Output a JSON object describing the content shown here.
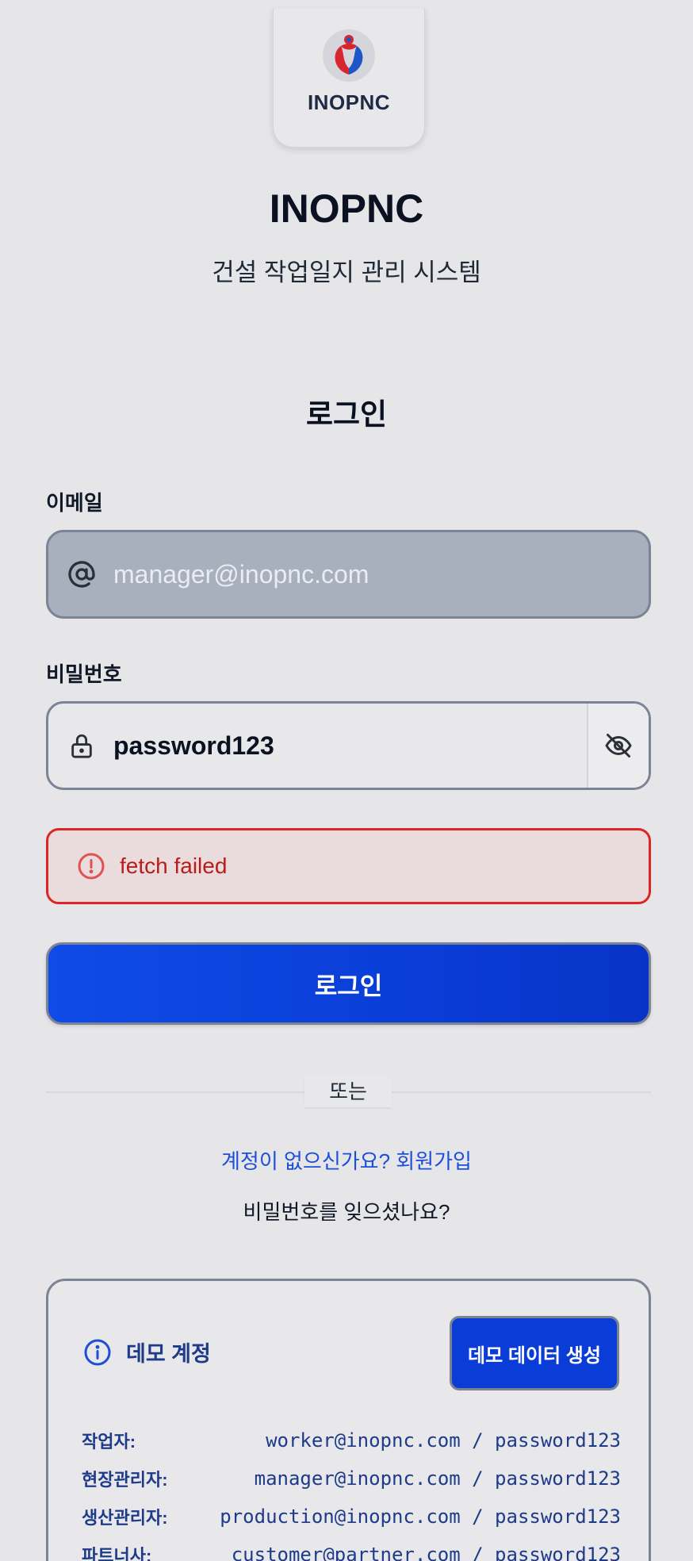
{
  "brand": {
    "logo_text": "INOPNC",
    "app_title": "INOPNC",
    "app_subtitle": "건설 작업일지 관리 시스템"
  },
  "login": {
    "title": "로그인",
    "email_label": "이메일",
    "email_placeholder": "manager@inopnc.com",
    "password_label": "비밀번호",
    "password_value": "password123",
    "error_message": "fetch failed",
    "submit_label": "로그인",
    "divider_text": "또는",
    "signup_link": "계정이 없으신가요? 회원가입",
    "forgot_link": "비밀번호를 잊으셨나요?"
  },
  "demo": {
    "title": "데모 계정",
    "generate_button": "데모 데이터 생성",
    "accounts": [
      {
        "role": "작업자:",
        "credential": "worker@inopnc.com / password123"
      },
      {
        "role": "현장관리자:",
        "credential": "manager@inopnc.com / password123"
      },
      {
        "role": "생산관리자:",
        "credential": "production@inopnc.com / password123"
      },
      {
        "role": "파트너사:",
        "credential": "customer@partner.com / password123"
      }
    ]
  },
  "colors": {
    "primary": "#0a3dd8",
    "error": "#dc2626",
    "background": "#e6e6e8"
  },
  "icons": {
    "email": "at-sign-icon",
    "password": "lock-icon",
    "toggle_visibility": "eye-off-icon",
    "error": "alert-circle-icon",
    "info": "info-icon"
  }
}
